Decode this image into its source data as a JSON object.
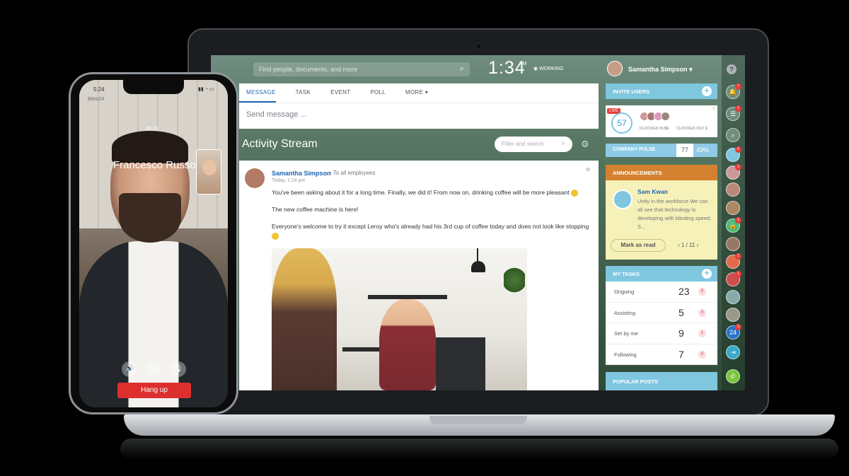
{
  "topbar": {
    "search_placeholder": "Find people, documents, and more",
    "clock": "1:34",
    "clock_suffix": "PM",
    "status": "WORKING",
    "user_name": "Samantha Simpson",
    "help_icon": "question-icon"
  },
  "composer": {
    "tabs": [
      "MESSAGE",
      "TASK",
      "EVENT",
      "POLL",
      "MORE"
    ],
    "placeholder": "Send message ..."
  },
  "stream": {
    "title": "Activity Stream",
    "filter_placeholder": "Filter and search"
  },
  "post": {
    "author": "Samantha Simpson",
    "audience": "To all employees",
    "time": "Today, 1:24 pm",
    "line1": "You've been asking about it for a long time. Finally, we did it! From now on, drinking coffee will be more pleasant",
    "line2": "The new coffee machine is here!",
    "line3": "Everyone's welcome to try it except Leroy who's already had his 3rd cup of coffee today and does not look like stopping"
  },
  "right_panel": {
    "invite": "INVITE USERS",
    "live": "LIVE",
    "pulse_value": "57",
    "clocked_in_label": "CLOCKED IN",
    "clocked_in": "51",
    "clocked_out_label": "CLOCKED OUT",
    "clocked_out": "1",
    "company_pulse": "COMPANY PULSE",
    "company_pulse_value": "77",
    "company_pulse_pct": "49%",
    "announcements": "ANNOUNCEMENTS",
    "ann_author": "Sam Kwan",
    "ann_text": "Unity in the workforce We can all see that technology is developing with blinding speed. S...",
    "mark_read": "Mark as read",
    "pager": "1 / 11",
    "my_tasks": "MY TASKS",
    "tasks": [
      {
        "label": "Ongoing",
        "value": "23",
        "badge": "0"
      },
      {
        "label": "Assisting",
        "value": "5",
        "badge": "0"
      },
      {
        "label": "Set by me",
        "value": "9",
        "badge": "1"
      },
      {
        "label": "Following",
        "value": "7",
        "badge": "0"
      }
    ],
    "popular_posts": "POPULAR POSTS"
  },
  "rail": {
    "items": [
      {
        "icon": "bell-icon",
        "badge": "7"
      },
      {
        "icon": "chat-icon",
        "badge": "1"
      },
      {
        "icon": "search-icon",
        "badge": ""
      },
      {
        "icon": "avatar",
        "badge": "2"
      },
      {
        "icon": "avatar",
        "badge": "1"
      },
      {
        "icon": "avatar",
        "badge": ""
      },
      {
        "icon": "avatar",
        "badge": ""
      },
      {
        "icon": "lock-icon",
        "badge": "1"
      },
      {
        "icon": "avatar",
        "badge": ""
      },
      {
        "icon": "avatar",
        "badge": "1"
      },
      {
        "icon": "avatar",
        "badge": "1"
      },
      {
        "icon": "avatar",
        "badge": ""
      },
      {
        "icon": "avatar",
        "badge": ""
      },
      {
        "icon": "bitrix24-icon",
        "badge": "1"
      },
      {
        "icon": "export-icon",
        "badge": ""
      },
      {
        "icon": "phone-icon",
        "badge": ""
      }
    ],
    "bitrix_label": "24"
  },
  "phone": {
    "time": "5:24",
    "subtitle": "Bitrix24",
    "elapsed": "00:23",
    "caller": "Francesco Russo",
    "hangup": "Hang up"
  }
}
